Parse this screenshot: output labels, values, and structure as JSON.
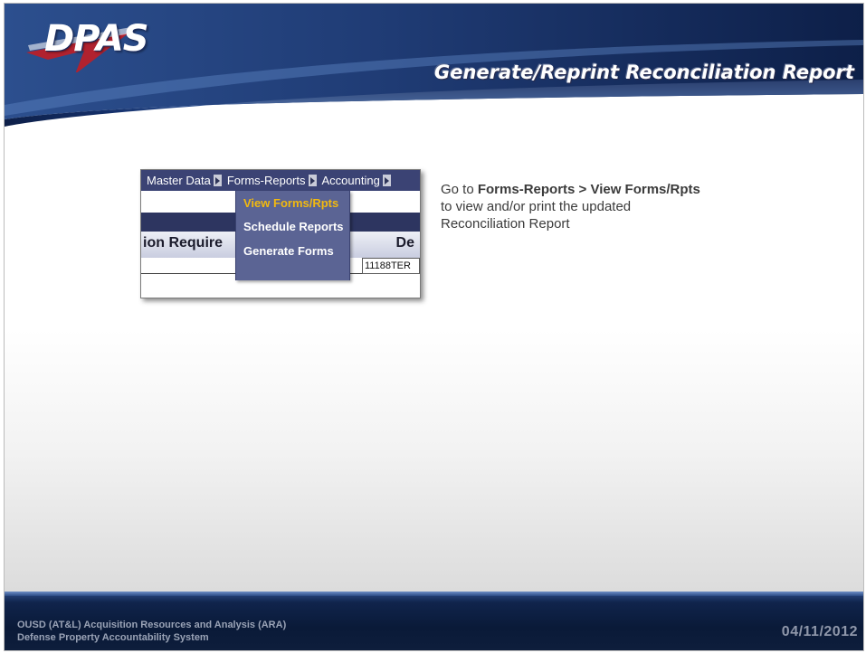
{
  "header": {
    "logo_text": "DPAS",
    "title": "Generate/Reprint Reconciliation Report"
  },
  "inset": {
    "menu": [
      "Master Data",
      "Forms-Reports",
      "Accounting"
    ],
    "dropdown": [
      "View Forms/Rpts",
      "Schedule Reports",
      "Generate Forms"
    ],
    "active_item": "View Forms/Rpts",
    "column_left": "ion Require",
    "column_right": "De",
    "cell_value": "11188TER"
  },
  "instruction": {
    "prefix": "Go to ",
    "path": "Forms-Reports > View Forms/Rpts",
    "rest": "to view and/or print the updated Reconciliation Report"
  },
  "footer": {
    "org_line1": "OUSD (AT&L) Acquisition Resources and Analysis (ARA)",
    "org_line2": "Defense Property Accountability System",
    "date": "04/11/2012"
  },
  "colors": {
    "header_navy": "#1c3566",
    "menu_bg": "#3b4374",
    "dropdown_bg": "#5b6494",
    "active_item": "#f2b90f",
    "footer_navy": "#0a1a38"
  }
}
